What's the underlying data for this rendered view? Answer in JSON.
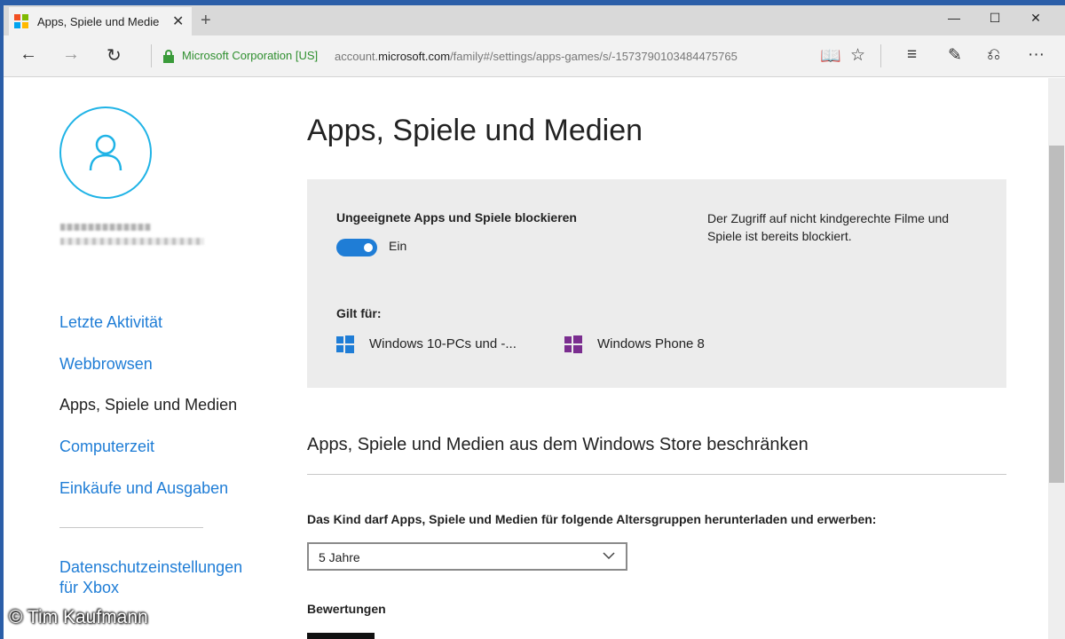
{
  "browser": {
    "tab_title": "Apps, Spiele und Medie",
    "tab_close": "✕",
    "new_tab": "+",
    "window_controls": {
      "minimize": "—",
      "maximize": "☐",
      "close": "✕"
    },
    "nav": {
      "back": "←",
      "forward": "→",
      "refresh": "↻"
    },
    "site_identity": "Microsoft Corporation [US]",
    "url_prefix": "account.",
    "url_domain": "microsoft.com",
    "url_path": "/family#/settings/apps-games/s/-1573790103484475765",
    "tools": {
      "reading_view": "📖",
      "favorite": "☆",
      "hub": "≡",
      "note": "✎",
      "share": "⎌",
      "more": "···"
    },
    "favicon_colors": [
      "#f25022",
      "#7fba00",
      "#00a4ef",
      "#ffb900"
    ]
  },
  "sidebar": {
    "items": [
      {
        "label": "Letzte Aktivität",
        "active": false
      },
      {
        "label": "Webbrowsen",
        "active": false
      },
      {
        "label": "Apps, Spiele und Medien",
        "active": true
      },
      {
        "label": "Computerzeit",
        "active": false
      },
      {
        "label": "Einkäufe und Ausgaben",
        "active": false
      }
    ],
    "xbox_link": "Datenschutzeinstellungen für Xbox"
  },
  "main": {
    "title": "Apps, Spiele und Medien",
    "block_card": {
      "label": "Ungeeignete Apps und Spiele blockieren",
      "toggle_state": "Ein",
      "note": "Der Zugriff auf nicht kindgerechte Filme und Spiele ist bereits blockiert.",
      "applies_label": "Gilt für:",
      "devices": [
        {
          "label": "Windows 10-PCs und -...",
          "icon": "windows-logo-icon",
          "color": "#1f7dd6"
        },
        {
          "label": "Windows Phone 8",
          "icon": "windows-logo-icon",
          "color": "#7a2d8f"
        }
      ]
    },
    "store_section_title": "Apps, Spiele und Medien aus dem Windows Store beschränken",
    "age_question": "Das Kind darf Apps, Spiele und Medien für folgende Altersgruppen herunterladen und erwerben:",
    "age_select_value": "5 Jahre",
    "ratings_label": "Bewertungen"
  },
  "watermark": "© Tim Kaufmann",
  "colors": {
    "accent": "#1f7dd6",
    "avatar_ring": "#1fb3e6",
    "secure": "#2f8f2f"
  }
}
